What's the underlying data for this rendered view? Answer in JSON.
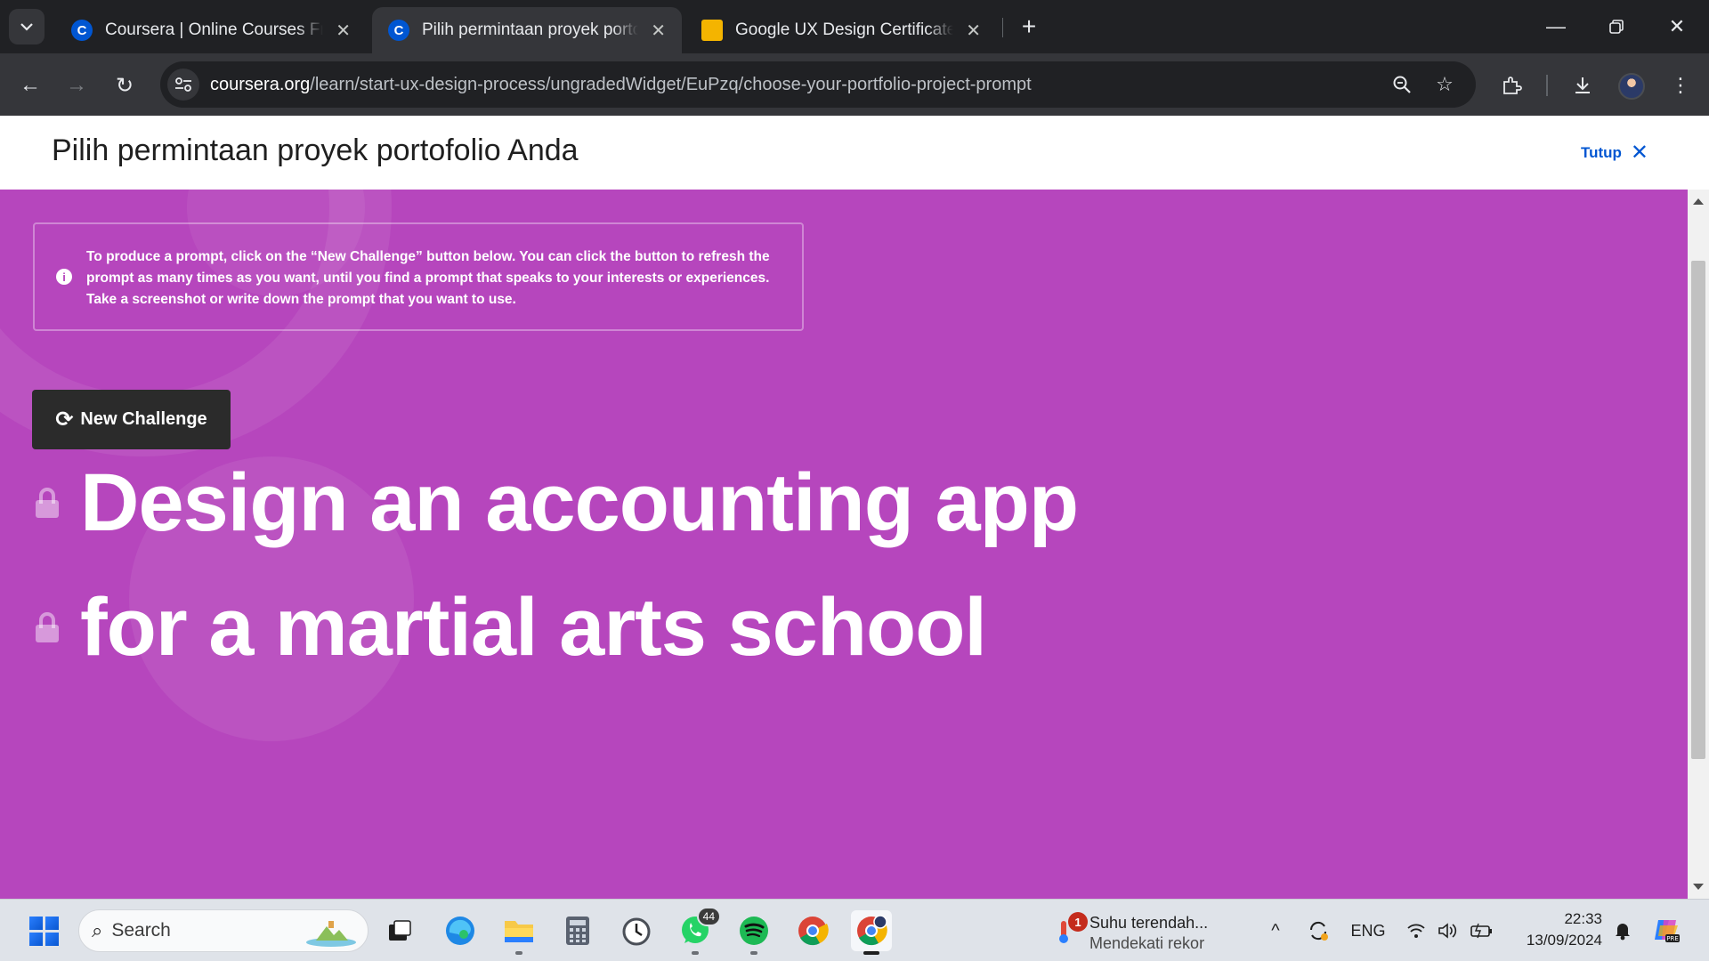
{
  "browser": {
    "tabs": [
      {
        "title": "Coursera | Online Courses From Top Universities",
        "favicon": "coursera-icon",
        "active": false
      },
      {
        "title": "Pilih permintaan proyek portofolio Anda",
        "favicon": "coursera-icon",
        "active": true
      },
      {
        "title": "Google UX Design Certificate - Slides",
        "favicon": "slides-icon",
        "active": false
      }
    ],
    "url_host": "coursera.org",
    "url_path": "/learn/start-ux-design-process/ungradedWidget/EuPzq/choose-your-portfolio-project-prompt",
    "favicon_letter": "C"
  },
  "page": {
    "title": "Pilih permintaan proyek portofolio Anda",
    "close_label": "Tutup",
    "info_text": "To produce a prompt, click on the “New Challenge” button below. You can click the button to refresh the prompt as many times as you want, until you find a prompt that speaks to your interests or experiences. Take a screenshot or write down the prompt that you want to use.",
    "button_label": "New Challenge",
    "prompt_lines": [
      "Design an accounting app",
      "for a martial arts school"
    ],
    "accent_color": "#b646bd",
    "link_color": "#0056d2"
  },
  "taskbar": {
    "search_placeholder": "Search",
    "whatsapp_badge": "44",
    "weather_badge": "1",
    "weather_title": "Suhu terendah...",
    "weather_subtitle": "Mendekati rekor",
    "language": "ENG",
    "time": "22:33",
    "date": "13/09/2024"
  }
}
